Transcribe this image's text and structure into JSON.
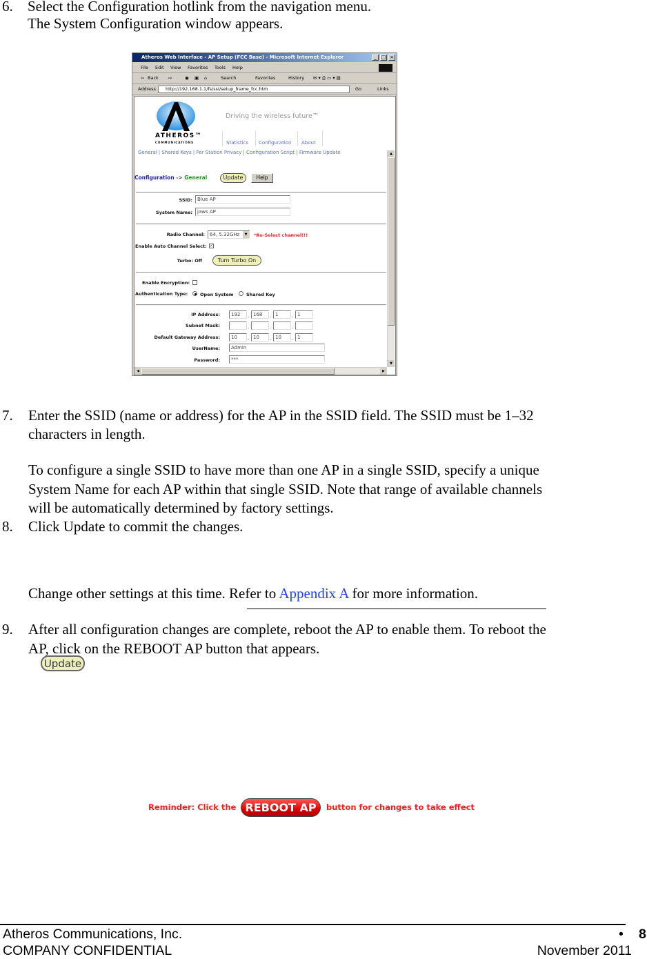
{
  "steps": {
    "s6": {
      "number": "6.",
      "line1": "Select the Configuration hotlink from the navigation menu.",
      "line2": "The System Configuration window appears."
    },
    "s7": {
      "number": "7.",
      "line1": "Enter the SSID (name or address) for the AP in the SSID field. The SSID must be 1–32",
      "line2": "characters in length.",
      "p2_line1": "To configure a single SSID to have more than one AP in a single SSID, specify a unique",
      "p2_line2": "System Name for each AP within that single SSID.  Note that range of available channels",
      "p2_line3": "will be automatically determined by factory settings."
    },
    "s8": {
      "number": "8.",
      "line1": "Click Update to commit the changes.",
      "other_pre": "Change other settings at this time. Refer to ",
      "other_link": "Appendix A",
      "other_post": " for more information."
    },
    "s9": {
      "number": "9.",
      "line1": "After all configuration changes are complete, reboot the AP to enable them. To reboot the",
      "line2": "AP, click on the REBOOT AP button that appears."
    }
  },
  "update_image": {
    "label": "Update"
  },
  "reminder": {
    "pre": "Reminder: Click the",
    "button": "REBOOT AP",
    "post": "button for changes to take effect",
    "color": "#ff1a1a"
  },
  "browser": {
    "title": "Atheros Web Interface - AP Setup (FCC Base) - Microsoft Internet Explorer",
    "menu": [
      "File",
      "Edit",
      "View",
      "Favorites",
      "Tools",
      "Help"
    ],
    "toolbar": [
      "Back",
      "Search",
      "Favorites",
      "History"
    ],
    "address_label": "Address",
    "url": "http://192.168.1.1/fs/ssi/setup_frame_fcc.htm",
    "go": "Go",
    "links": "Links",
    "page": {
      "tagline": "Driving the wireless future™",
      "logo_letter": "A",
      "logo_name": "ATHEROS™",
      "logo_sub": "COMMUNICATIONS",
      "nav": [
        "Statistics",
        "Configuration",
        "About"
      ],
      "subnav": "General | Shared Keys | Per Station Privacy | Configuration Script | Firmware Update",
      "crumb_section": "Configuration",
      "crumb_arrow": " -> ",
      "crumb_page": "General",
      "update_btn": "Update",
      "help_btn": "Help",
      "ssid_label": "SSID:",
      "ssid_value": "Blue AP",
      "sysname_label": "System Name:",
      "sysname_value": "jaws AP",
      "radio_label": "Radio Channel:",
      "radio_value": "64, 5.32GHz",
      "reselect": "*Re-Select channel!!!",
      "auto_label": "Enable Auto Channel Select:",
      "auto_checked": true,
      "turbo_label": "Turbo: Off",
      "turbo_btn": "Turn Turbo On",
      "enc_label": "Enable Encryption:",
      "enc_checked": false,
      "auth_label": "Authentication Type:",
      "auth_open": "Open System",
      "auth_shared": "Shared Key",
      "auth_selected": "Open System",
      "ip_label": "IP Address:",
      "ip": [
        "192",
        "168",
        "1",
        "1"
      ],
      "mask_label": "Subnet Mask:",
      "mask": [
        "",
        "",
        "",
        ""
      ],
      "gw_label": "Default Gateway Address:",
      "gw": [
        "10",
        "10",
        "10",
        "1"
      ],
      "user_label": "UserName:",
      "user_value": "Admin",
      "pass_label": "Password:",
      "pass_value": "***"
    }
  },
  "footer": {
    "company": "Atheros Communications, Inc.",
    "confidential": "COMPANY CONFIDENTIAL",
    "bullet": "•",
    "page": "8",
    "date": "November 2011"
  }
}
